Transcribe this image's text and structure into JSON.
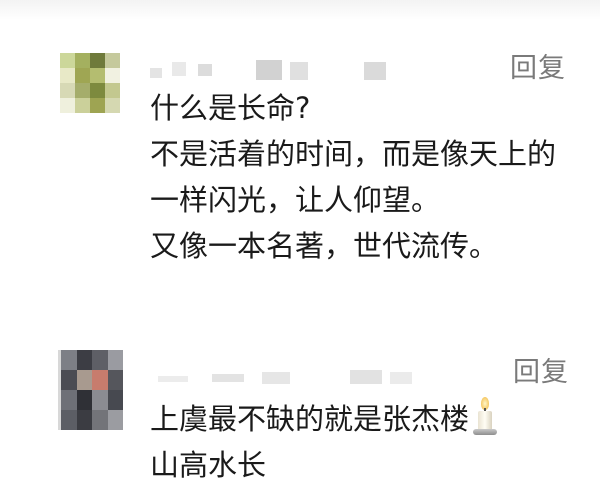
{
  "comments": [
    {
      "reply_label": "回复",
      "lines": [
        "什么是长命?",
        "不是活着的时间，而是像天上的",
        "一样闪光，让人仰望。",
        "又像一本名著，世代流传。"
      ]
    },
    {
      "reply_label": "回复",
      "lines": [
        "上虞最不缺的就是张杰楼",
        "山高水长"
      ],
      "emoji_icon": "candle-icon"
    }
  ]
}
